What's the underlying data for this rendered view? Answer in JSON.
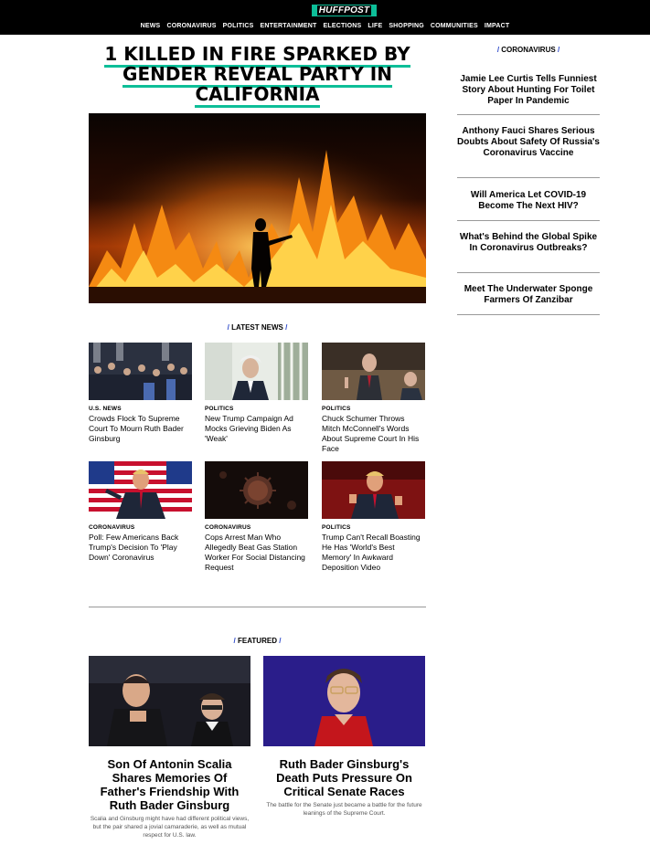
{
  "logo": {
    "text": "HUFFPOST"
  },
  "nav": [
    "NEWS",
    "CORONAVIRUS",
    "POLITICS",
    "ENTERTAINMENT",
    "ELECTIONS",
    "LIFE",
    "SHOPPING",
    "COMMUNITIES",
    "IMPACT"
  ],
  "headline": {
    "text": "1 KILLED IN FIRE SPARKED BY GENDER REVEAL PARTY IN CALIFORNIA"
  },
  "latest": {
    "label": "LATEST NEWS",
    "cards": [
      {
        "category": "U.S. NEWS",
        "title": "Crowds Flock To Supreme Court To Mourn Ruth Bader Ginsburg"
      },
      {
        "category": "POLITICS",
        "title": "New Trump Campaign Ad Mocks Grieving Biden As 'Weak'"
      },
      {
        "category": "POLITICS",
        "title": "Chuck Schumer Throws Mitch McConnell's Words About Supreme Court In His Face"
      },
      {
        "category": "CORONAVIRUS",
        "title": "Poll: Few Americans Back Trump's Decision To 'Play Down' Coronavirus"
      },
      {
        "category": "CORONAVIRUS",
        "title": "Cops Arrest Man Who Allegedly Beat Gas Station Worker For Social Distancing Request"
      },
      {
        "category": "POLITICS",
        "title": "Trump Can't Recall Boasting He Has 'World's Best Memory' In Awkward Deposition Video"
      }
    ]
  },
  "featured": {
    "label": "FEATURED",
    "items": [
      {
        "title": "Son Of Antonin Scalia Shares Memories Of Father's Friendship With Ruth Bader Ginsburg",
        "desc": "Scalia and Ginsburg might have had different political views, but the pair shared a jovial camaraderie, as well as mutual respect for U.S. law."
      },
      {
        "title": "Ruth Bader Ginsburg's Death Puts Pressure On Critical Senate Races",
        "desc": "The battle for the Senate just became a battle for the future leanings of the Supreme Court."
      }
    ]
  },
  "sidebar": {
    "label": "CORONAVIRUS",
    "items": [
      "Jamie Lee Curtis Tells Funniest Story About Hunting For Toilet Paper In Pandemic",
      "Anthony Fauci Shares Serious Doubts About Safety Of Russia's Coronavirus Vaccine",
      "Will America Let COVID-19 Become The Next HIV?",
      "What's Behind the Global Spike In Coronavirus Outbreaks?",
      "Meet The Underwater Sponge Farmers Of Zanzibar"
    ]
  },
  "colors": {
    "accent": "#0dbe98",
    "slash": "#2a47c9"
  }
}
